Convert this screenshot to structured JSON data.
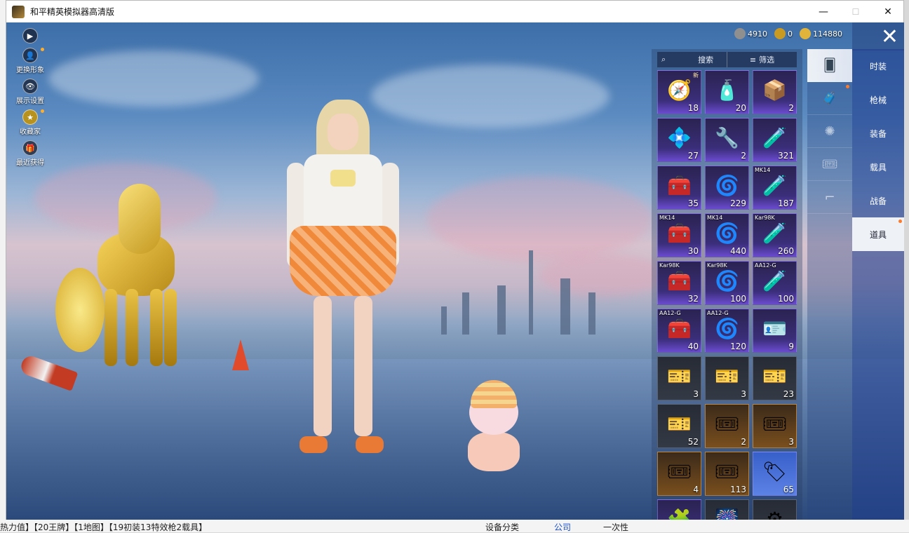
{
  "window": {
    "title": "和平精英模拟器高清版",
    "minimize": "—",
    "maximize": "☐",
    "close": "✕"
  },
  "left_menu": [
    {
      "label": "",
      "icon": "play-icon"
    },
    {
      "label": "更换形象",
      "icon": "avatar-icon"
    },
    {
      "label": "展示设置",
      "icon": "eye-icon"
    },
    {
      "label": "收藏家",
      "icon": "collector-badge-icon"
    },
    {
      "label": "最近获得",
      "icon": "gift-icon"
    }
  ],
  "currency": [
    {
      "name": "silver-coin",
      "value": "4910",
      "color": "#8f8f8f"
    },
    {
      "name": "gold-ticket",
      "value": "0",
      "color": "#c99a22"
    },
    {
      "name": "gold-coin",
      "value": "114880",
      "color": "#e0b43a"
    }
  ],
  "inventory": {
    "search_label": "搜索",
    "filter_label": "筛选",
    "items": [
      {
        "count": "18",
        "tag": "",
        "badge": "新",
        "style": "purple",
        "glyph": "🧭"
      },
      {
        "count": "20",
        "tag": "",
        "badge": "",
        "style": "purple",
        "glyph": "🧴"
      },
      {
        "count": "2",
        "tag": "",
        "badge": "",
        "style": "purple",
        "glyph": "📦"
      },
      {
        "count": "27",
        "tag": "",
        "badge": "",
        "style": "purple",
        "glyph": "💠"
      },
      {
        "count": "2",
        "tag": "",
        "badge": "",
        "style": "purple",
        "glyph": "🔧"
      },
      {
        "count": "321",
        "tag": "",
        "badge": "",
        "style": "purple",
        "glyph": "🧪"
      },
      {
        "count": "35",
        "tag": "",
        "badge": "",
        "style": "purple",
        "glyph": "🧰"
      },
      {
        "count": "229",
        "tag": "",
        "badge": "",
        "style": "purple",
        "glyph": "🌀"
      },
      {
        "count": "187",
        "tag": "MK14",
        "badge": "",
        "style": "purple",
        "glyph": "🧪"
      },
      {
        "count": "30",
        "tag": "MK14",
        "badge": "",
        "style": "purple",
        "glyph": "🧰"
      },
      {
        "count": "440",
        "tag": "MK14",
        "badge": "",
        "style": "purple",
        "glyph": "🌀"
      },
      {
        "count": "260",
        "tag": "Kar98K",
        "badge": "",
        "style": "purple",
        "glyph": "🧪"
      },
      {
        "count": "32",
        "tag": "Kar98K",
        "badge": "",
        "style": "purple",
        "glyph": "🧰"
      },
      {
        "count": "100",
        "tag": "Kar98K",
        "badge": "",
        "style": "purple",
        "glyph": "🌀"
      },
      {
        "count": "100",
        "tag": "AA12-G",
        "badge": "",
        "style": "purple",
        "glyph": "🧪"
      },
      {
        "count": "40",
        "tag": "AA12-G",
        "badge": "",
        "style": "purple",
        "glyph": "🧰"
      },
      {
        "count": "120",
        "tag": "AA12-G",
        "badge": "",
        "style": "purple",
        "glyph": "🌀"
      },
      {
        "count": "9",
        "tag": "",
        "badge": "",
        "style": "purple",
        "glyph": "🪪"
      },
      {
        "count": "3",
        "tag": "",
        "badge": "",
        "style": "dark",
        "glyph": "🎫"
      },
      {
        "count": "3",
        "tag": "",
        "badge": "",
        "style": "dark",
        "glyph": "🎫"
      },
      {
        "count": "23",
        "tag": "",
        "badge": "",
        "style": "dark",
        "glyph": "🎫"
      },
      {
        "count": "52",
        "tag": "",
        "badge": "",
        "style": "dark",
        "glyph": "🎫"
      },
      {
        "count": "2",
        "tag": "",
        "badge": "",
        "style": "gold",
        "glyph": "🎟"
      },
      {
        "count": "3",
        "tag": "",
        "badge": "",
        "style": "gold",
        "glyph": "🎟"
      },
      {
        "count": "4",
        "tag": "",
        "badge": "",
        "style": "gold",
        "glyph": "🎟"
      },
      {
        "count": "113",
        "tag": "",
        "badge": "",
        "style": "gold",
        "glyph": "🎟"
      },
      {
        "count": "65",
        "tag": "",
        "badge": "",
        "style": "blue",
        "glyph": "🏷"
      },
      {
        "count": "",
        "tag": "",
        "badge": "",
        "style": "purple",
        "glyph": "🧩"
      },
      {
        "count": "",
        "tag": "",
        "badge": "",
        "style": "dark",
        "glyph": "🎆"
      },
      {
        "count": "",
        "tag": "",
        "badge": "",
        "style": "dark",
        "glyph": "⚙"
      }
    ]
  },
  "categories": [
    {
      "icon": "card-icon",
      "active": true
    },
    {
      "icon": "chest-icon",
      "active": false,
      "dot": true
    },
    {
      "icon": "firework-icon",
      "active": false
    },
    {
      "icon": "ticket-icon",
      "active": false
    },
    {
      "icon": "rifle-icon",
      "active": false
    }
  ],
  "tabs": [
    {
      "label": "时装"
    },
    {
      "label": "枪械"
    },
    {
      "label": "装备"
    },
    {
      "label": "载具"
    },
    {
      "label": "战备"
    },
    {
      "label": "道具",
      "active": true
    }
  ],
  "host_bottom": {
    "left_text": "热力值】【20王牌】【1地图】【19初装13特效枪2载具】",
    "mid_text": "设备分类",
    "opt1": "公司",
    "opt2": "一次性"
  }
}
